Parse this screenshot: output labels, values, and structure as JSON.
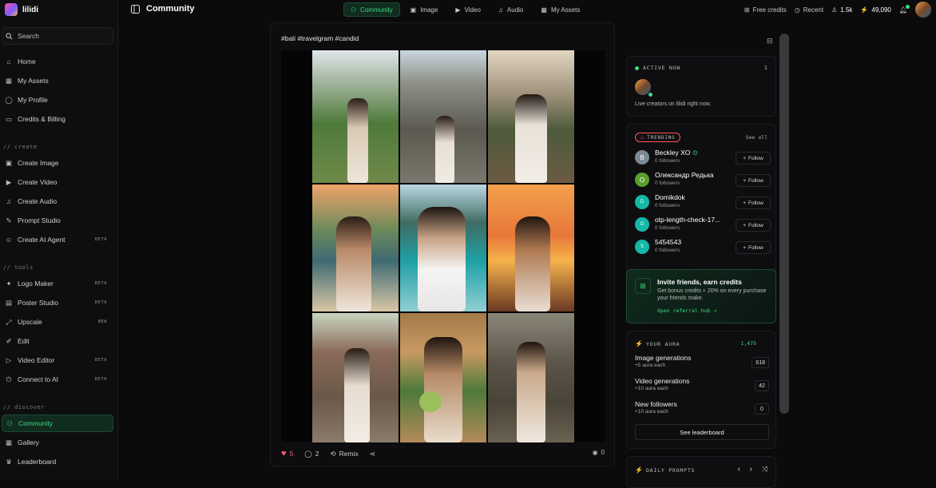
{
  "app": {
    "name": "lilidi"
  },
  "sidebar": {
    "search_label": "Search",
    "main_items": [
      {
        "label": "Home",
        "icon": "home-icon"
      },
      {
        "label": "My Assets",
        "icon": "assets-icon"
      },
      {
        "label": "My Profile",
        "icon": "profile-icon"
      },
      {
        "label": "Credits & Billing",
        "icon": "credit-card-icon"
      }
    ],
    "sections": {
      "create": "// create",
      "tools": "// tools",
      "discover": "// discover"
    },
    "create_items": [
      {
        "label": "Create Image",
        "badge": ""
      },
      {
        "label": "Create Video",
        "badge": ""
      },
      {
        "label": "Create Audio",
        "badge": ""
      },
      {
        "label": "Prompt Studio",
        "badge": ""
      },
      {
        "label": "Create AI Agent",
        "badge": "BETA"
      }
    ],
    "tool_items": [
      {
        "label": "Logo Maker",
        "badge": "BETA"
      },
      {
        "label": "Poster Studio",
        "badge": "BETA"
      },
      {
        "label": "Upscale",
        "badge": "NEW"
      },
      {
        "label": "Edit",
        "badge": ""
      },
      {
        "label": "Video Editor",
        "badge": "BETA"
      },
      {
        "label": "Connect to AI",
        "badge": "BETA"
      }
    ],
    "discover_items": [
      {
        "label": "Community",
        "active": true
      },
      {
        "label": "Gallery"
      },
      {
        "label": "Leaderboard"
      }
    ]
  },
  "header": {
    "title": "Community",
    "tabs": [
      {
        "label": "Community",
        "active": true
      },
      {
        "label": "Image"
      },
      {
        "label": "Video"
      },
      {
        "label": "Audio"
      },
      {
        "label": "My Assets"
      }
    ],
    "free_credits": "Free credits",
    "recent": "Recent",
    "followers_count": "1.5k",
    "credits_balance": "49,090"
  },
  "post": {
    "caption": "#bali #travelgram #candid",
    "likes": "5",
    "comments": "2",
    "remix_label": "Remix",
    "views": "0"
  },
  "active_now": {
    "label": "ACTIVE NOW",
    "count": "1",
    "text": "Live creators on lilidi right now."
  },
  "trending": {
    "label": "TRENDING",
    "see_all": "See all",
    "follow_label": "Follow",
    "users": [
      {
        "initial": "B",
        "name": "Beckley XO",
        "followers": "0 followers",
        "color": "#7a8a96",
        "verified": true
      },
      {
        "initial": "O",
        "name": "Олександр Редька",
        "followers": "0 followers",
        "color": "#5aa02c"
      },
      {
        "initial": "D",
        "name": "Domikdok",
        "followers": "0 followers",
        "color": "#15b8a6"
      },
      {
        "initial": "O",
        "name": "otp-length-check-17...",
        "followers": "0 followers",
        "color": "#15b8a6"
      },
      {
        "initial": "5",
        "name": "5454543",
        "followers": "0 followers",
        "color": "#15b8a6"
      }
    ]
  },
  "invite": {
    "title": "Invite friends, earn credits",
    "text": "Get bonus credits + 20% on every purchase your friends make.",
    "link": "Open referral hub ↗"
  },
  "aura": {
    "label": "YOUR AURA",
    "total": "1,475",
    "rows": [
      {
        "title": "Image generations",
        "sub": "+5 aura each",
        "value": "618"
      },
      {
        "title": "Video generations",
        "sub": "+10 aura each",
        "value": "42"
      },
      {
        "title": "New followers",
        "sub": "+10 aura each",
        "value": "0"
      }
    ],
    "leaderboard_label": "See leaderboard"
  },
  "daily_prompts": {
    "label": "DAILY PROMPTS"
  },
  "colors": {
    "accent": "#3ddc84",
    "like": "#ff5a7a",
    "trending": "#ff5a5a"
  }
}
